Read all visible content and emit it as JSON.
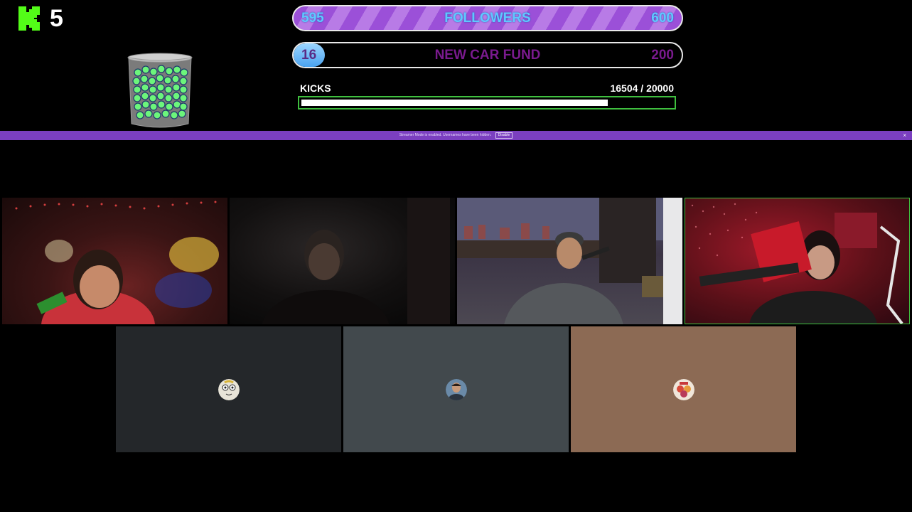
{
  "kick_counter": {
    "value": "5",
    "logo_color": "#53fc18"
  },
  "goals": {
    "followers": {
      "current": "595",
      "title": "FOLLOWERS",
      "target": "600",
      "progress": 0.992
    },
    "car_fund": {
      "current": "16",
      "title": "NEW CAR FUND",
      "target": "200",
      "progress": 0.08
    }
  },
  "kicks": {
    "label": "KICKS",
    "count": "16504  / 20000",
    "progress": 0.825
  },
  "banner": {
    "text": "Streamer Mode is enabled. Usernames have been hidden.",
    "button": "Disable",
    "close": "×"
  },
  "colors": {
    "accent": "#7b3fc0",
    "kick_green": "#53fc18",
    "tile_active_border": "#3fbf3f"
  },
  "tiles": [
    {
      "kind": "video",
      "icon": "camera-feed"
    },
    {
      "kind": "video",
      "icon": "camera-feed"
    },
    {
      "kind": "video",
      "icon": "camera-feed"
    },
    {
      "kind": "video",
      "icon": "camera-feed",
      "active_speaker": true
    },
    {
      "kind": "avatar",
      "icon": "avatar-icon"
    },
    {
      "kind": "avatar",
      "icon": "avatar-icon"
    },
    {
      "kind": "avatar",
      "icon": "avatar-icon"
    }
  ]
}
